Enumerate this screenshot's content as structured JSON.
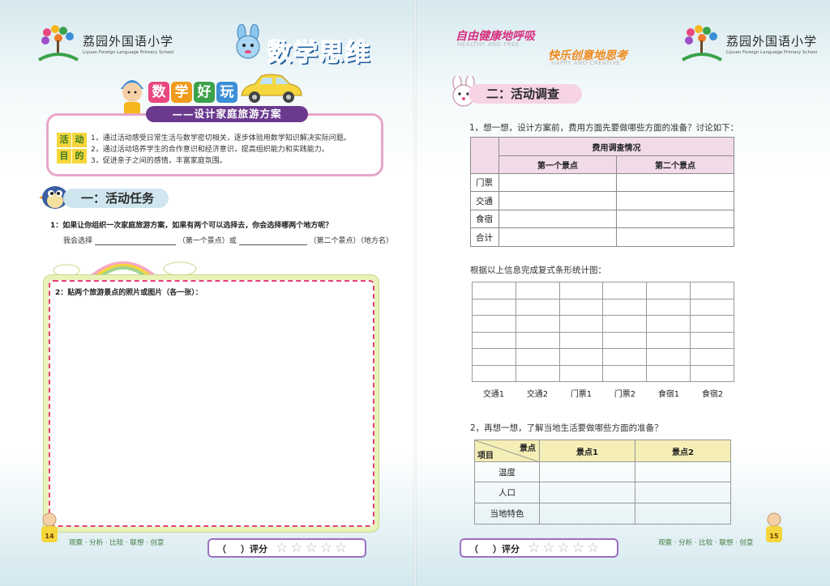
{
  "left": {
    "logo": {
      "cn": "荔园外国语小学",
      "en": "Liyuan Foreign Language Primary School"
    },
    "title": "数学思维",
    "fun_title": [
      "数",
      "学",
      "好",
      "玩"
    ],
    "subtitle": "——设计家庭旅游方案",
    "goal_labels": [
      "活",
      "动",
      "目",
      "的"
    ],
    "goals": [
      "1，通过活动感受日常生活与数学密切相关，逐步体验用数学知识解决实际问题。",
      "2，通过活动培养学生的合作意识和经济意识，提高组织能力和实践能力。",
      "3，促进亲子之间的感情，丰富家庭氛围。"
    ],
    "section1": "一：活动任务",
    "q1": "1：如果让你组织一次家庭旅游方案，如果有两个可以选择去，你会选择哪两个地方呢？",
    "q1_answer": {
      "prefix": "我会选择",
      "mid": "（第一个景点）或",
      "suffix": "（第二个景点）（地方名）"
    },
    "q2": "2：贴两个旅游景点的照片或图片（各一张）：",
    "footer": "观察 · 分析 · 比较 · 联想 · 创意",
    "score": {
      "open": "（",
      "close": "）评分",
      "stars": "☆☆☆☆☆"
    },
    "page_number": "14"
  },
  "right": {
    "logo": {
      "cn": "荔园外国语小学",
      "en": "Liyuan Foreign Language Primary School"
    },
    "slogan1": "自由健康地呼吸",
    "slogan1_en": "HEALTHY AND FREE",
    "slogan2": "快乐创意地思考",
    "slogan2_en": "HAPPY AND CREATIVE",
    "section2": "二：活动调查",
    "q1": "1，想一想，设计方案前，费用方面先要做哪些方面的准备？讨论如下：",
    "cost_table": {
      "header_top": "费用调查情况",
      "header_cols": [
        "第一个景点",
        "第二个景点"
      ],
      "rows": [
        "门票",
        "交通",
        "食宿",
        "合计"
      ]
    },
    "chart_prompt": "根据以上信息完成复式条形统计图：",
    "chart_data": {
      "type": "bar",
      "categories": [
        "交通1",
        "交通2",
        "门票1",
        "门票2",
        "食宿1",
        "食宿2"
      ],
      "series": [],
      "title": "",
      "xlabel": "",
      "ylabel": "",
      "grid": true
    },
    "q2": "2，再想一想，了解当地生活要做哪些方面的准备？",
    "local_table": {
      "corner_top": "景点",
      "corner_bottom": "项目",
      "cols": [
        "景点1",
        "景点2"
      ],
      "rows": [
        "温度",
        "人口",
        "当地特色"
      ]
    },
    "footer": "观察 · 分析 · 比较 · 联想 · 创意",
    "score": {
      "open": "（",
      "close": "）评分",
      "stars": "☆☆☆☆☆"
    },
    "page_number": "15"
  },
  "colors": {
    "fun_title_bg": [
      "#e8487f",
      "#f09b1c",
      "#3aa24a",
      "#3b8fd6"
    ],
    "score_border": "#9c6fc6",
    "photo_dash": "#e2436f"
  }
}
